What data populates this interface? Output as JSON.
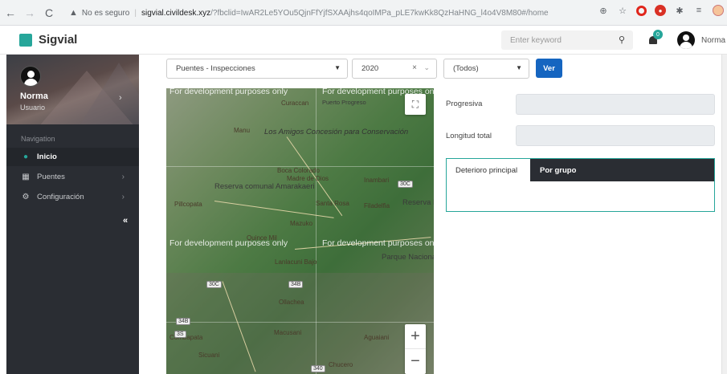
{
  "browser": {
    "security_label": "No es seguro",
    "host": "sigvial.civildesk.xyz",
    "path": "/?fbclid=IwAR2Le5YOu5QjnFfYjfSXAAjhs4qoIMPa_pLE7kwKk8QzHaHNG_l4o4V8M80#/home"
  },
  "header": {
    "brand": "Sigvial",
    "search_placeholder": "Enter keyword",
    "notifications_count": "0",
    "user_name": "Norma"
  },
  "sidebar": {
    "profile_name": "Norma",
    "profile_role": "Usuario",
    "section_label": "Navigation",
    "items": [
      {
        "label": "Inicio",
        "icon": "map-pin-icon"
      },
      {
        "label": "Puentes",
        "icon": "grid-icon"
      },
      {
        "label": "Configuración",
        "icon": "gears-icon"
      }
    ],
    "collapse_symbol": "«"
  },
  "filters": {
    "report_select": "Puentes - Inspecciones",
    "year_select": "2020",
    "status_select": "(Todos)",
    "submit_label": "Ver"
  },
  "map": {
    "watermark": "For development purposes only",
    "labels": {
      "curacao": "Curaccan",
      "puerto_progreso": "Puerto Progreso",
      "manu": "Manu",
      "los_amigos": "Los Amigos Concesión para Conservación",
      "boca_colorado": "Boca Colorado",
      "madre_de_dios": "Madre de Dios",
      "inambari": "Inambari",
      "reserva_amarakaeri": "Reserva comunal Amarakaeri",
      "pillcopata": "Pillcopata",
      "santa_rosa": "Santa Rosa",
      "filadelfia": "Filadelfia",
      "reserva_tambopata": "Reserva Nacional Tambopata",
      "mazuko": "Mazuko",
      "quince_mil": "Quince Mil",
      "lanlacuni_bajo": "Lanlacuni Bajo",
      "parque_bahuaja": "Parque Nacional Bahuaja Sonene",
      "ollachea": "Ollachea",
      "combapata": "Combapata",
      "macusani": "Macusani",
      "aguaiani": "Aguaiani",
      "sicuani": "Sicuani",
      "chucero": "Chucero",
      "r30c": "30C",
      "r30c_b": "30C",
      "r34b": "34B",
      "r34b_b": "34B",
      "r3s": "3S",
      "r340": "340"
    },
    "zoom_in": "+",
    "zoom_out": "−"
  },
  "panel": {
    "progresiva_label": "Progresiva",
    "progresiva_value": "",
    "longitud_label": "Longitud total",
    "longitud_value": "",
    "tabs": [
      "Deterioro principal",
      "Por grupo"
    ]
  },
  "colors": {
    "accent": "#26a69a",
    "sidebar_bg": "#2a2d33",
    "primary_button": "#1565c0"
  }
}
